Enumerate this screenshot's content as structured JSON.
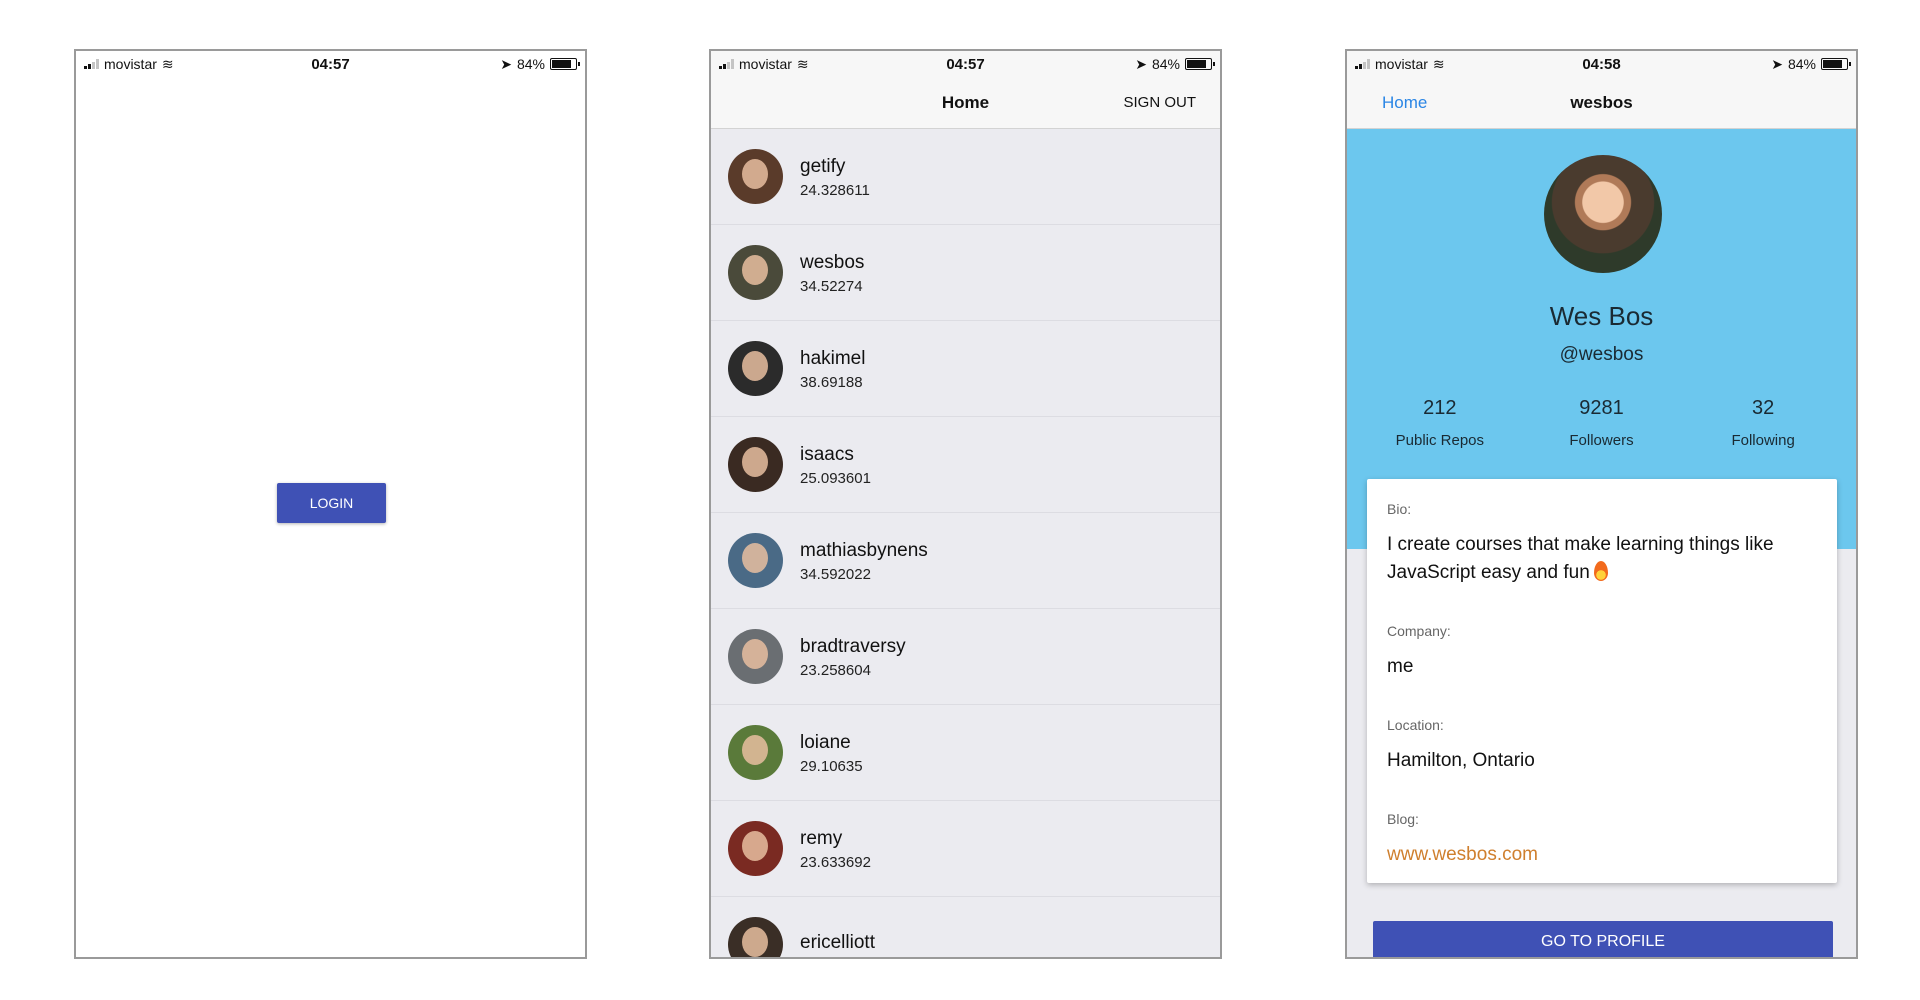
{
  "status": {
    "login": {
      "carrier": "movistar",
      "time": "04:57",
      "battery": "84%"
    },
    "list": {
      "carrier": "movistar",
      "time": "04:57",
      "battery": "84%"
    },
    "profile": {
      "carrier": "movistar",
      "time": "04:58",
      "battery": "84%"
    },
    "battery_level": 0.84
  },
  "login": {
    "button_label": "LOGIN"
  },
  "list_screen": {
    "title": "Home",
    "sign_out": "SIGN OUT",
    "users": [
      {
        "name": "getify",
        "score": "24.328611",
        "avatar_color": "#5a3b2a"
      },
      {
        "name": "wesbos",
        "score": "34.52274",
        "avatar_color": "#4a4a3a"
      },
      {
        "name": "hakimel",
        "score": "38.69188",
        "avatar_color": "#2b2b2b"
      },
      {
        "name": "isaacs",
        "score": "25.093601",
        "avatar_color": "#3a2a22"
      },
      {
        "name": "mathiasbynens",
        "score": "34.592022",
        "avatar_color": "#4a6a86"
      },
      {
        "name": "bradtraversy",
        "score": "23.258604",
        "avatar_color": "#6a6e72"
      },
      {
        "name": "loiane",
        "score": "29.10635",
        "avatar_color": "#5a7a3a"
      },
      {
        "name": "remy",
        "score": "23.633692",
        "avatar_color": "#7a2a22"
      },
      {
        "name": "ericelliott",
        "score": "",
        "avatar_color": "#3a2e26"
      }
    ]
  },
  "profile_screen": {
    "back": "Home",
    "title": "wesbos",
    "name": "Wes Bos",
    "handle": "@wesbos",
    "stats": [
      {
        "value": "212",
        "label": "Public Repos"
      },
      {
        "value": "9281",
        "label": "Followers"
      },
      {
        "value": "32",
        "label": "Following"
      }
    ],
    "bio_label": "Bio:",
    "bio": "I create courses that make learning things like JavaScript easy and fun",
    "company_label": "Company:",
    "company": "me",
    "location_label": "Location:",
    "location": "Hamilton, Ontario",
    "blog_label": "Blog:",
    "blog": "www.wesbos.com",
    "go_button": "GO TO PROFILE"
  },
  "colors": {
    "primary": "#3f51b5",
    "hero": "#6cc7ee",
    "link": "#cf7f2e",
    "nav_link": "#2b86e5"
  }
}
